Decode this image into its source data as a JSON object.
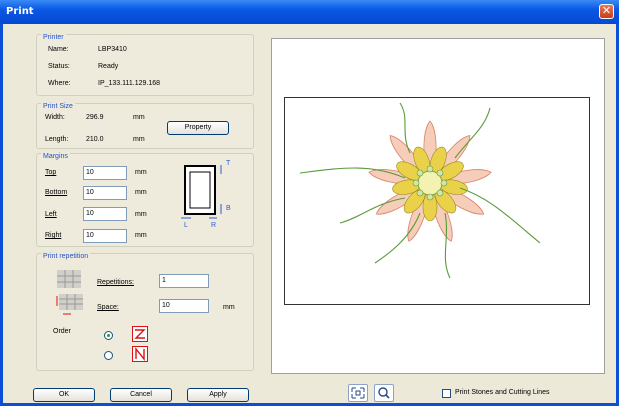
{
  "window": {
    "title": "Print",
    "close_glyph": "✕"
  },
  "printer": {
    "title": "Printer",
    "name_label": "Name:",
    "name_value": "LBP3410",
    "status_label": "Status:",
    "status_value": "Ready",
    "where_label": "Where:",
    "where_value": "IP_133.111.129.168"
  },
  "print_size": {
    "title": "Print Size",
    "width_label": "Width:",
    "width_value": "296.9",
    "width_unit": "mm",
    "length_label": "Length:",
    "length_value": "210.0",
    "length_unit": "mm",
    "property_button": "Property"
  },
  "margins": {
    "title": "Margins",
    "top_label": "Top",
    "top_value": "10",
    "bottom_label": "Bottom",
    "bottom_value": "10",
    "left_label": "Left",
    "left_value": "10",
    "right_label": "Right",
    "right_value": "10",
    "unit": "mm",
    "diagram": {
      "t": "T",
      "b": "B",
      "l": "L",
      "r": "R"
    }
  },
  "print_repetition": {
    "title": "Print repetition",
    "repetitions_label": "Repetitions:",
    "repetitions_value": "1",
    "space_label": "Space:",
    "space_value": "10",
    "space_unit": "mm",
    "order_label": "Order",
    "order_selected": 0
  },
  "footer": {
    "ok": "OK",
    "cancel": "Cancel",
    "apply": "Apply",
    "checkbox_label": "Print Stones and Cutting Lines",
    "checkbox_checked": false
  },
  "icons": [
    "close-icon",
    "fit-icon",
    "zoom-icon",
    "grid-icon",
    "space-icon",
    "order-z-icon",
    "order-n-icon"
  ],
  "colors": {
    "title_bar": "#0a58e6",
    "group_title": "#2350c8",
    "order_icon": "#d11"
  }
}
